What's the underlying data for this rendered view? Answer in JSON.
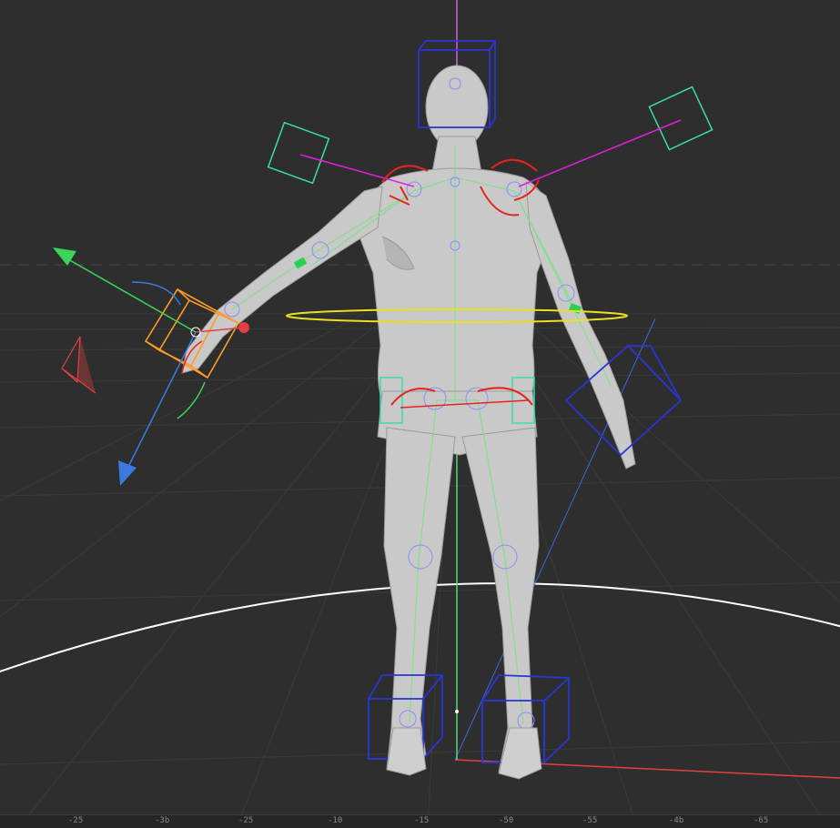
{
  "viewport": {
    "name": "3D Viewport",
    "background": "#2e2e2e",
    "grid_color": "#3a3a3a",
    "horizon_color": "#4a4a4a"
  },
  "colors": {
    "skin": "#c8c8c8",
    "bone": "#7fe08a",
    "ik_control": "#2a35d6",
    "pole_target": "#38e0a6",
    "selected": "#ff9a2a",
    "rotation_ring": "#e8231e",
    "root_ring": "#e8e020",
    "ground_circle": "#ffffff",
    "axis_x": "#e04040",
    "axis_y": "#3ad65a",
    "axis_z": "#3a7ae0",
    "pole_line": "#e020e0"
  },
  "scene": {
    "model": "human-figure",
    "rig": "armature-with-ik",
    "selected_control": "hand-ik-control-right",
    "gizmo": "move-rotate-gizmo"
  },
  "ruler": {
    "labels": [
      "-25",
      "-3b",
      "-25",
      "-10",
      "-15",
      "-50",
      "-55",
      "-4b",
      "-65"
    ]
  }
}
